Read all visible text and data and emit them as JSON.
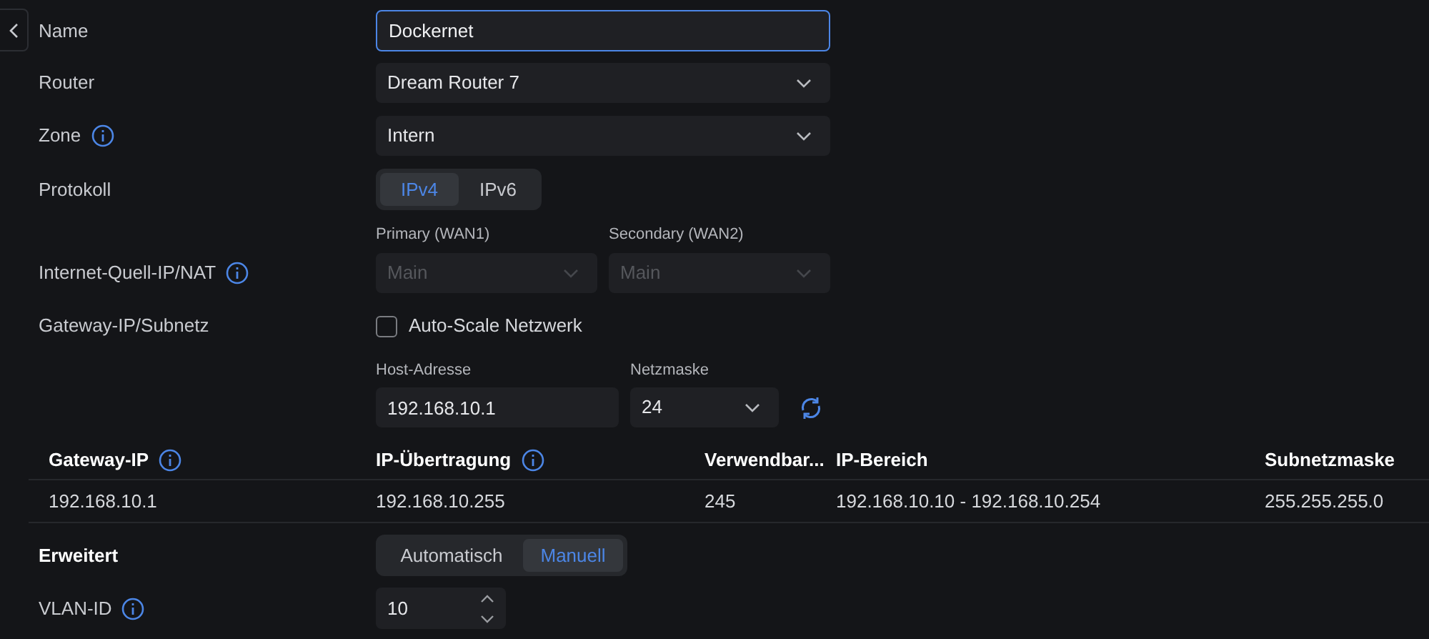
{
  "name": {
    "label": "Name",
    "value": "Dockernet",
    "focused": true
  },
  "router": {
    "label": "Router",
    "value": "Dream Router 7"
  },
  "zone": {
    "label": "Zone",
    "value": "Intern",
    "info": true
  },
  "protocol": {
    "label": "Protokoll",
    "options": [
      {
        "label": "IPv4",
        "selected": true
      },
      {
        "label": "IPv6",
        "selected": false
      }
    ]
  },
  "internet_source": {
    "label": "Internet-Quell-IP/NAT",
    "info": true,
    "selects": [
      {
        "label": "Primary (WAN1)",
        "value": "Main",
        "disabled": true
      },
      {
        "label": "Secondary (WAN2)",
        "value": "Main",
        "disabled": true
      }
    ]
  },
  "gateway": {
    "label": "Gateway-IP/Subnetz",
    "auto_scale": {
      "label": "Auto-Scale Netzwerk",
      "checked": false
    },
    "host": {
      "label": "Host-Adresse",
      "value": "192.168.10.1"
    },
    "netmask": {
      "label": "Netzmaske",
      "value": "24"
    }
  },
  "table": {
    "columns": [
      {
        "label": "Gateway-IP",
        "info": true
      },
      {
        "label": "IP-Übertragung",
        "info": true
      },
      {
        "label": "Verwendbar...",
        "info": false
      },
      {
        "label": "IP-Bereich",
        "info": false
      },
      {
        "label": "Subnetzmaske",
        "info": false
      }
    ],
    "rows": [
      [
        "192.168.10.1",
        "192.168.10.255",
        "245",
        "192.168.10.10 - 192.168.10.254",
        "255.255.255.0"
      ]
    ]
  },
  "advanced": {
    "label": "Erweitert",
    "options": [
      {
        "label": "Automatisch",
        "selected": false
      },
      {
        "label": "Manuell",
        "selected": true
      }
    ]
  },
  "vlan": {
    "label": "VLAN-ID",
    "info": true,
    "value": "10"
  }
}
